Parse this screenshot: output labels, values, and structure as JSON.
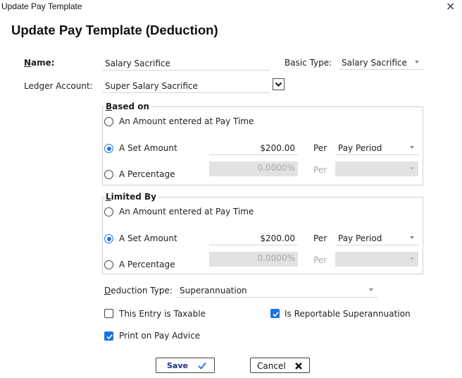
{
  "window": {
    "title": "Update Pay Template",
    "close_glyph": "×"
  },
  "heading": "Update Pay Template (Deduction)",
  "name": {
    "label": "Name:",
    "value": "Salary Sacrifice"
  },
  "basic_type": {
    "label": "Basic Type:",
    "value": "Salary Sacrifice"
  },
  "ledger": {
    "label": "Ledger Account:",
    "value": "Super Salary Sacrifice"
  },
  "based_on": {
    "title": "Based on",
    "options": [
      {
        "label": "An Amount entered at Pay Time",
        "selected": false
      },
      {
        "label": "A Set Amount",
        "selected": true,
        "amount": "$200.00",
        "per_label": "Per",
        "per_value": "Pay Period"
      },
      {
        "label": "A Percentage",
        "selected": false,
        "amount": "0.0000%",
        "per_label": "Per",
        "per_value": ""
      }
    ]
  },
  "limited_by": {
    "title": "Limited By",
    "options": [
      {
        "label": "An Amount entered at Pay Time",
        "selected": false
      },
      {
        "label": "A Set Amount",
        "selected": true,
        "amount": "$200.00",
        "per_label": "Per",
        "per_value": "Pay Period"
      },
      {
        "label": "A Percentage",
        "selected": false,
        "amount": "0.0000%",
        "per_label": "Per",
        "per_value": ""
      }
    ]
  },
  "deduction_type": {
    "label": "Deduction Type:",
    "value": "Superannuation"
  },
  "checkboxes": {
    "taxable": {
      "label": "This Entry is Taxable",
      "checked": false
    },
    "reportable_super": {
      "label": "Is Reportable Superannuation",
      "checked": true
    },
    "print_on_advice": {
      "label": "Print on Pay Advice",
      "checked": true
    }
  },
  "buttons": {
    "save": "Save",
    "cancel": "Cancel"
  },
  "colors": {
    "accent": "#1a73e8",
    "save_text": "#1f2d8a",
    "save_check": "#2b7bd6"
  }
}
